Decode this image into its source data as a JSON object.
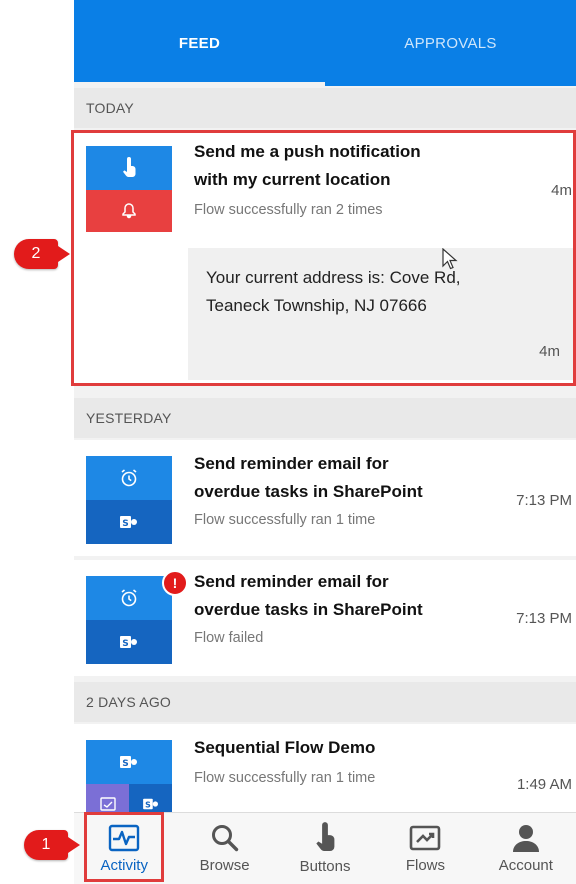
{
  "tabs": {
    "feed": "FEED",
    "approvals": "APPROVALS"
  },
  "sections": {
    "today": "TODAY",
    "yesterday": "YESTERDAY",
    "two_days": "2 DAYS AGO"
  },
  "cards": {
    "push": {
      "title_line1": "Send me a push notification",
      "title_line2": "with my current location",
      "subtitle": "Flow successfully ran 2 times",
      "time": "4m",
      "detail_line1": "Your current address is: Cove Rd,",
      "detail_line2": "Teaneck Township, NJ 07666",
      "detail_time": "4m"
    },
    "reminder1": {
      "title_line1": "Send reminder email for",
      "title_line2": "overdue tasks in SharePoint",
      "subtitle": "Flow successfully ran 1 time",
      "time": "7:13 PM"
    },
    "reminder2": {
      "title_line1": "Send reminder email for",
      "title_line2": "overdue tasks in SharePoint",
      "subtitle": "Flow failed",
      "time": "7:13 PM",
      "error_badge": "!"
    },
    "sequential": {
      "title": "Sequential Flow Demo",
      "subtitle": "Flow successfully ran 1 time",
      "time": "1:49 AM"
    }
  },
  "nav": {
    "activity": "Activity",
    "browse": "Browse",
    "buttons": "Buttons",
    "flows": "Flows",
    "account": "Account"
  },
  "annotations": {
    "one": "1",
    "two": "2"
  },
  "colors": {
    "brand_blue": "#0a7fe6",
    "push_red": "#e84040",
    "blue_light": "#1e88e5",
    "blue_dark": "#1565c0",
    "purple": "#7b6fd6",
    "annot_red": "#e03c3c"
  }
}
